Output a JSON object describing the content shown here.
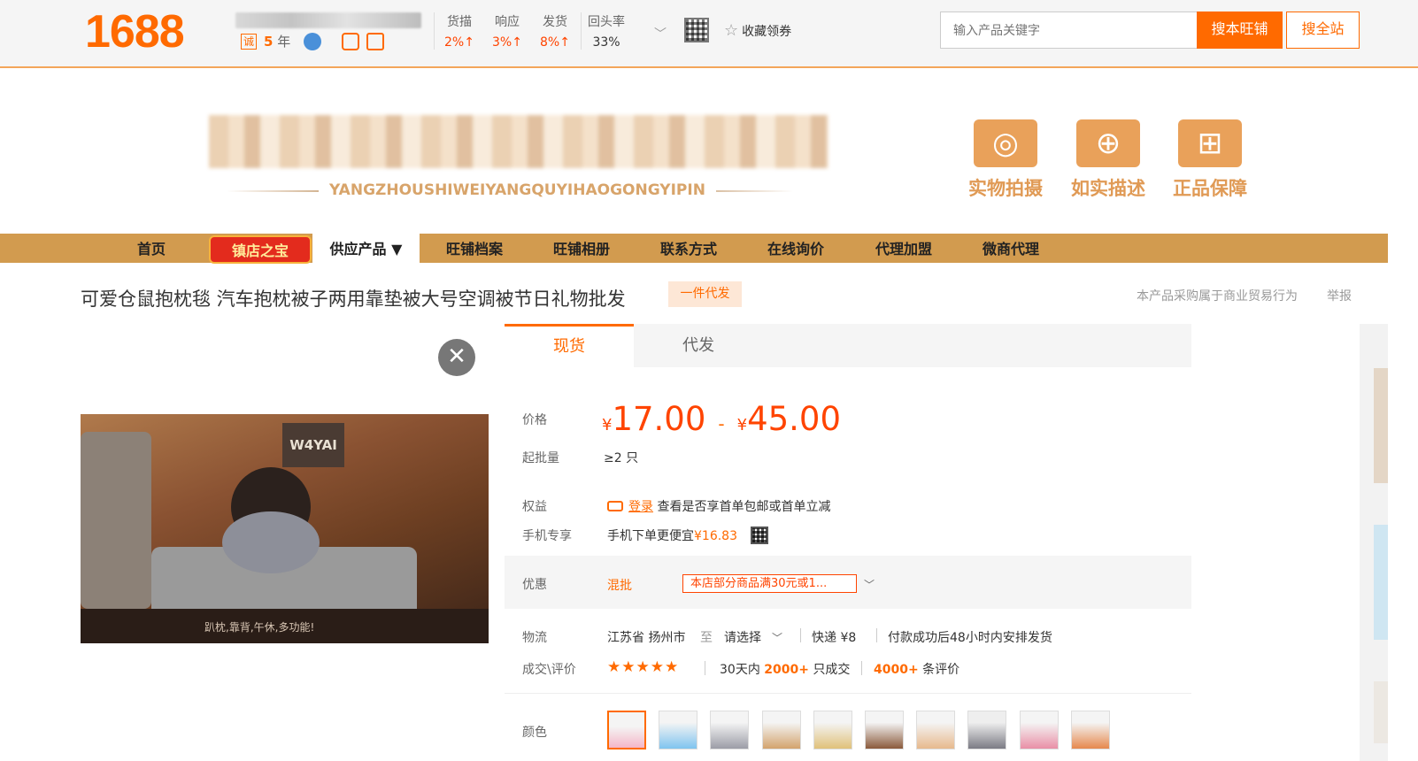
{
  "header": {
    "logo": "1688",
    "cheng": "诚",
    "years_num": "5",
    "years_unit": "年",
    "metrics": [
      {
        "label": "货描",
        "value": "2%↑"
      },
      {
        "label": "响应",
        "value": "3%↑"
      },
      {
        "label": "发货",
        "value": "8%↑"
      },
      {
        "label": "回头率",
        "value": "33%"
      }
    ],
    "favorite": "收藏领券",
    "search_placeholder": "输入产品关键字",
    "search_shop_btn": "搜本旺铺",
    "search_all_btn": "搜全站"
  },
  "banner": {
    "subtitle": "YANGZHOUSHIWEIYANGQUYIHAOGONGYIPIN",
    "features": [
      "实物拍摄",
      "如实描述",
      "正品保障"
    ]
  },
  "nav": {
    "items": [
      "首页",
      "镇店之宝",
      "供应产品 ▼",
      "旺铺档案",
      "旺铺相册",
      "联系方式",
      "在线询价",
      "代理加盟",
      "微商代理"
    ]
  },
  "product": {
    "title": "可爱仓鼠抱枕毯 汽车抱枕被子两用靠垫被大号空调被节日礼物批发",
    "tag": "一件代发",
    "note": "本产品采购属于商业贸易行为",
    "report": "举报",
    "photo_board": "W4YAI",
    "photo_caption": "趴枕,靠背,午休,多功能!",
    "tabs": [
      "现货",
      "代发"
    ],
    "labels": {
      "price": "价格",
      "moq": "起批量",
      "rights": "权益",
      "mobile": "手机专享",
      "promo": "优惠",
      "logistics": "物流",
      "deal": "成交\\评价",
      "color": "颜色"
    },
    "price_currency": "¥",
    "price_low": "17.00",
    "price_high": "45.00",
    "price_dash": "-",
    "moq": "≥2 只",
    "login": "登录",
    "rights_text": "查看是否享首单包邮或首单立减",
    "mobile_text": "手机下单更便宜",
    "mobile_price": "¥16.83",
    "promo_type": "混批",
    "promo_coupon": "本店部分商品满30元或1...",
    "ship_from": "江苏省 扬州市",
    "ship_to_word": "至",
    "ship_select": "请选择",
    "express": "快递 ¥8",
    "ship_time": "付款成功后48小时内安排发货",
    "stars": "★★★★★",
    "sales_prefix": "30天内",
    "sales_num": "2000+",
    "sales_suffix": "只成交",
    "reviews_num": "4000+",
    "reviews_suffix": "条评价"
  },
  "colors": {
    "accent": "#ff6a00",
    "nav_bg": "#d29b4f",
    "price": "#ff4400"
  }
}
